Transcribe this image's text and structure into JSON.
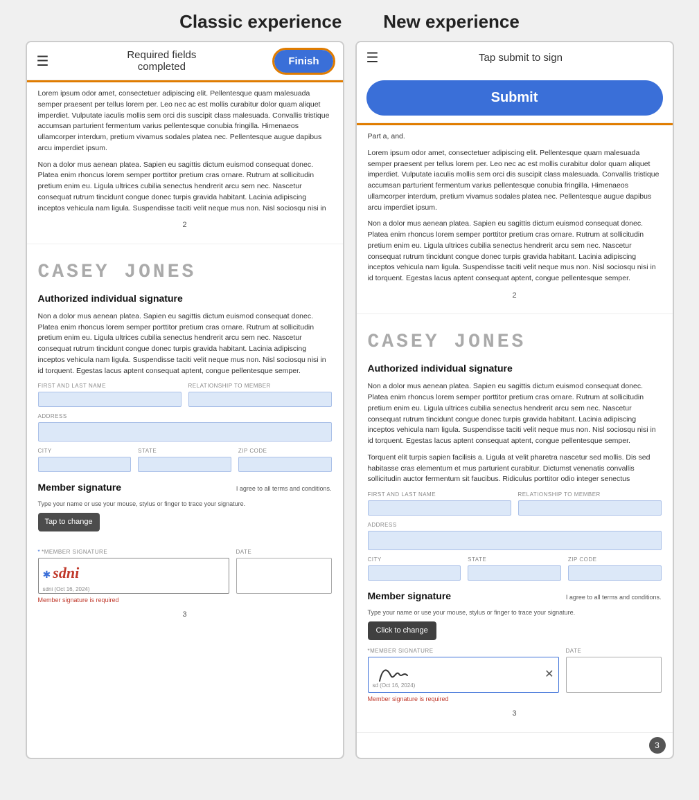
{
  "classic": {
    "title": "Classic experience",
    "topbar": {
      "title_line1": "Required fields",
      "title_line2": "completed",
      "finish_btn": "Finish"
    },
    "lorem1": "Lorem ipsum odor amet, consectetuer adipiscing elit. Pellentesque quam malesuada semper praesent per tellus lorem per. Leo nec ac est mollis curabitur dolor quam aliquet imperdiet. Vulputate iaculis mollis sem orci dis suscipit class malesuada. Convallis tristique accumsan parturient fermentum varius pellentesque conubia fringilla. Himenaeos ullamcorper interdum, pretium vivamus sodales platea nec. Pellentesque augue dapibus arcu imperdiet ipsum.",
    "lorem2": "Non a dolor mus aenean platea. Sapien eu sagittis dictum euismod consequat donec. Platea enim rhoncus lorem semper porttitor pretium cras ornare. Rutrum at sollicitudin pretium enim eu. Ligula ultrices cubilia senectus hendrerit arcu sem nec. Nascetur consequat rutrum tincidunt congue donec turpis gravida habitant. Lacinia adipiscing inceptos vehicula nam ligula. Suspendisse taciti velit neque mus non. Nisl sociosqu nisi in",
    "page_number": "2",
    "sig_name": "CASEY JONES",
    "sig_heading": "Authorized individual signature",
    "sig_body": "Non a dolor mus aenean platea. Sapien eu sagittis dictum euismod consequat donec. Platea enim rhoncus lorem semper porttitor pretium cras ornare. Rutrum at sollicitudin pretium enim eu. Ligula ultrices cubilia senectus hendrerit arcu sem nec. Nascetur consequat rutrum tincidunt congue donec turpis gravida habitant. Lacinia adipiscing inceptos vehicula nam ligula. Suspendisse taciti velit neque mus non. Nisl sociosqu nisi in id torquent. Egestas lacus aptent consequat aptent, congue pellentesque semper.",
    "fields": {
      "first_last": "FIRST AND LAST NAME",
      "relationship": "RELATIONSHIP TO MEMBER",
      "address": "ADDRESS",
      "city": "CITY",
      "state": "STATE",
      "zip": "ZIP CODE"
    },
    "member_sig": {
      "heading": "Member signature",
      "agree": "I agree to all terms and conditions.",
      "trace": "Type your name or use your mouse, stylus or finger to trace your signature.",
      "sig_label": "*MEMBER SIGNATURE",
      "date_label": "DATE",
      "sig_value": "sdni",
      "sig_date": "sdni   (Oct 16, 2024)",
      "required_msg": "Member signature is required",
      "tap_tooltip": "Tap to change"
    },
    "page3": "3"
  },
  "new": {
    "title": "New experience",
    "topbar": {
      "title": "Tap submit to sign"
    },
    "submit_btn": "Submit",
    "lorem1": "Part a, and.",
    "lorem1b": "Lorem ipsum odor amet, consectetuer adipiscing elit. Pellentesque quam malesuada semper praesent per tellus lorem per. Leo nec ac est mollis curabitur dolor quam aliquet imperdiet. Vulputate iaculis mollis sem orci dis suscipit class malesuada. Convallis tristique accumsan parturient fermentum varius pellentesque conubia fringilla. Himenaeos ullamcorper interdum, pretium vivamus sodales platea nec. Pellentesque augue dapibus arcu imperdiet ipsum.",
    "lorem2": "Non a dolor mus aenean platea. Sapien eu sagittis dictum euismod consequat donec. Platea enim rhoncus lorem semper porttitor pretium cras ornare. Rutrum at sollicitudin pretium enim eu. Ligula ultrices cubilia senectus hendrerit arcu sem nec. Nascetur consequat rutrum tincidunt congue donec turpis gravida habitant. Lacinia adipiscing inceptos vehicula nam ligula. Suspendisse taciti velit neque mus non. Nisl sociosqu nisi in id torquent. Egestas lacus aptent consequat aptent, congue pellentesque semper.",
    "page_number": "2",
    "sig_name": "CASEY JONES",
    "sig_heading": "Authorized individual signature",
    "sig_body": "Non a dolor mus aenean platea. Sapien eu sagittis dictum euismod consequat donec. Platea enim rhoncus lorem semper porttitor pretium cras ornare. Rutrum at sollicitudin pretium enim eu. Ligula ultrices cubilia senectus hendrerit arcu sem nec. Nascetur consequat rutrum tincidunt congue donec turpis gravida habitant. Lacinia adipiscing inceptos vehicula nam ligula. Suspendisse taciti velit neque mus non. Nisl sociosqu nisi in id torquent. Egestas lacus aptent consequat aptent, congue pellentesque semper.",
    "sig_body2": "Torquent elit turpis sapien facilisis a. Ligula at velit pharetra nascetur sed mollis. Dis sed habitasse cras elementum et mus parturient curabitur. Dictumst venenatis convallis sollicitudin auctor fermentum sit faucibus. Ridiculus porttitor odio integer senectus",
    "fields": {
      "first_last": "FIRST AND LAST NAME",
      "relationship": "RELATIONSHIP TO MEMBER",
      "address": "ADDRESS",
      "city": "CITY",
      "state": "STATE",
      "zip": "ZIP CODE"
    },
    "member_sig": {
      "heading": "Member signature",
      "agree": "I agree to all terms and conditions.",
      "trace": "Type your name or use your mouse, stylus or finger to trace your signature.",
      "sig_label": "*MEMBER SIGNATURE",
      "date_label": "DATE",
      "sig_value": "sd",
      "sig_date": "sd (Oct 16, 2024)",
      "required_msg": "Member signature is required",
      "click_tooltip": "Click to change"
    },
    "page3": "3",
    "bottom_page": "3"
  }
}
